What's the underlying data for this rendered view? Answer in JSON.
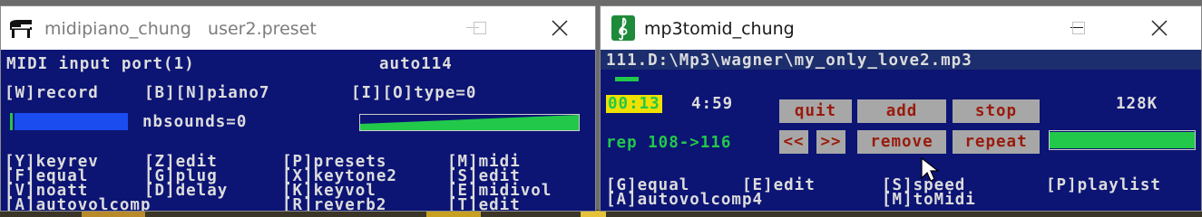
{
  "window1": {
    "title": "midipiano_chung",
    "preset": "user2.preset",
    "lines": {
      "midi_port": "MIDI input port(1)",
      "auto": "auto114",
      "record": "[W]record",
      "piano": "[B][N]piano7",
      "type": "[I][O]type=0",
      "nbsounds": "nbsounds=0"
    },
    "menu": {
      "col1": [
        "[Y]keyrev",
        "[F]equal",
        "[V]noatt",
        "[A]autovolcomp"
      ],
      "col2": [
        "[Z]edit",
        "[G]plug",
        "[D]delay",
        ""
      ],
      "col3": [
        "[P]presets",
        "[X]keytone2",
        "[K]keyvol",
        "[R]reverb2"
      ],
      "col4": [
        "[M]midi",
        "[S]edit",
        "[E]midivol",
        "[T]edit"
      ]
    }
  },
  "window2": {
    "title": "mp3tomid_chung",
    "path": "111.D:\\Mp3\\wagner\\my_only_love2.mp3",
    "elapsed": "00:13",
    "total": "4:59",
    "bitrate": "128K",
    "rep": "rep 108->116",
    "buttons": {
      "prev": "<<",
      "next": ">>",
      "quit": "quit",
      "add": "add",
      "stop": "stop",
      "remove": "remove",
      "repeat": "repeat"
    },
    "menu": {
      "equal": "[G]equal",
      "edit": "[E]edit",
      "speed": "[S]speed",
      "playlist": "[P]playlist",
      "autovolcomp4": "[A]autovolcomp4",
      "tomidi": "[M]toMidi"
    }
  },
  "colors": {
    "client_bg": "#0c1474",
    "text": "#dcdcdc",
    "green": "#22c84a",
    "blue_bar": "#1a4cf0",
    "button_bg": "#a7a7a7",
    "button_text": "#9a1a0c",
    "time_highlight": "#f0e000"
  }
}
